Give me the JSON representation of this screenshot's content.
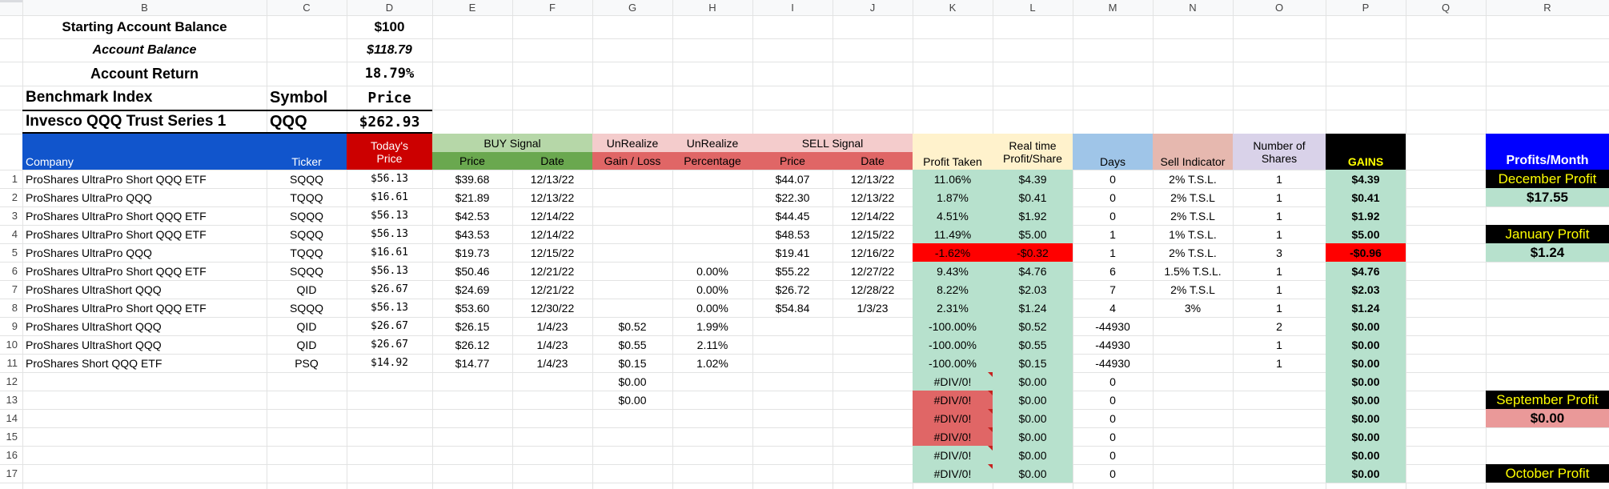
{
  "columns": [
    "B",
    "C",
    "D",
    "E",
    "F",
    "G",
    "H",
    "I",
    "J",
    "K",
    "L",
    "M",
    "N",
    "O",
    "P",
    "Q",
    "R"
  ],
  "summary": {
    "starting_balance_label": "Starting Account Balance",
    "starting_balance_value": "$100",
    "account_balance_label": "Account Balance",
    "account_balance_value": "$118.79",
    "account_return_label": "Account Return",
    "account_return_value": "18.79%",
    "benchmark_label": "Benchmark Index",
    "symbol_label": "Symbol",
    "price_label": "Price",
    "benchmark_name": "Invesco QQQ Trust Series 1",
    "benchmark_symbol": "QQQ",
    "benchmark_price": "$262.93"
  },
  "headers": {
    "company": "Company",
    "ticker": "Ticker",
    "todays_price_1": "Today's",
    "todays_price_2": "Price",
    "buy_signal": "BUY Signal",
    "buy_price": "Price",
    "buy_date": "Date",
    "unrealize_gl_top": "UnRealize",
    "unrealize_gl_bottom": "Gain / Loss",
    "unrealize_pct_top": "UnRealize",
    "unrealize_pct_bottom": "Percentage",
    "sell_signal": "SELL Signal",
    "sell_price": "Price",
    "sell_date": "Date",
    "profit_taken": "Profit Taken",
    "realtime_1": "Real time",
    "realtime_2": "Profit/Share",
    "days": "Days",
    "sell_indicator": "Sell Indicator",
    "num_shares_1": "Number of",
    "num_shares_2": "Shares",
    "gains": "GAINS",
    "profits_month": "Profits/Month"
  },
  "rows": [
    {
      "n": "1",
      "company": "ProShares UltraPro Short QQQ ETF",
      "ticker": "SQQQ",
      "today": "$56.13",
      "bp": "$39.68",
      "bd": "12/13/22",
      "gl": "",
      "pct": "",
      "sp": "$44.07",
      "sd": "12/13/22",
      "pt": "11.06%",
      "rt": "$4.39",
      "days": "0",
      "si": "2% T.S.L.",
      "sh": "1",
      "gain": "$4.39"
    },
    {
      "n": "2",
      "company": "ProShares UltraPro QQQ",
      "ticker": "TQQQ",
      "today": "$16.61",
      "bp": "$21.89",
      "bd": "12/13/22",
      "gl": "",
      "pct": "",
      "sp": "$22.30",
      "sd": "12/13/22",
      "pt": "1.87%",
      "rt": "$0.41",
      "days": "0",
      "si": "2% T.S.L",
      "sh": "1",
      "gain": "$0.41"
    },
    {
      "n": "3",
      "company": "ProShares UltraPro Short QQQ ETF",
      "ticker": "SQQQ",
      "today": "$56.13",
      "bp": "$42.53",
      "bd": "12/14/22",
      "gl": "",
      "pct": "",
      "sp": "$44.45",
      "sd": "12/14/22",
      "pt": "4.51%",
      "rt": "$1.92",
      "days": "0",
      "si": "2% T.S.L",
      "sh": "1",
      "gain": "$1.92"
    },
    {
      "n": "4",
      "company": "ProShares UltraPro Short QQQ ETF",
      "ticker": "SQQQ",
      "today": "$56.13",
      "bp": "$43.53",
      "bd": "12/14/22",
      "gl": "",
      "pct": "",
      "sp": "$48.53",
      "sd": "12/15/22",
      "pt": "11.49%",
      "rt": "$5.00",
      "days": "1",
      "si": "1% T.S.L.",
      "sh": "1",
      "gain": "$5.00"
    },
    {
      "n": "5",
      "company": "ProShares UltraPro QQQ",
      "ticker": "TQQQ",
      "today": "$16.61",
      "bp": "$19.73",
      "bd": "12/15/22",
      "gl": "",
      "pct": "",
      "sp": "$19.41",
      "sd": "12/16/22",
      "pt": "-1.62%",
      "rt": "-$0.32",
      "days": "1",
      "si": "2% T.S.L.",
      "sh": "3",
      "gain": "-$0.96"
    },
    {
      "n": "6",
      "company": "ProShares UltraPro Short QQQ ETF",
      "ticker": "SQQQ",
      "today": "$56.13",
      "bp": "$50.46",
      "bd": "12/21/22",
      "gl": "",
      "pct": "0.00%",
      "sp": "$55.22",
      "sd": "12/27/22",
      "pt": "9.43%",
      "rt": "$4.76",
      "days": "6",
      "si": "1.5% T.S.L.",
      "sh": "1",
      "gain": "$4.76"
    },
    {
      "n": "7",
      "company": "ProShares UltraShort QQQ",
      "ticker": "QID",
      "today": "$26.67",
      "bp": "$24.69",
      "bd": "12/21/22",
      "gl": "",
      "pct": "0.00%",
      "sp": "$26.72",
      "sd": "12/28/22",
      "pt": "8.22%",
      "rt": "$2.03",
      "days": "7",
      "si": "2% T.S.L",
      "sh": "1",
      "gain": "$2.03"
    },
    {
      "n": "8",
      "company": "ProShares UltraPro Short QQQ ETF",
      "ticker": "SQQQ",
      "today": "$56.13",
      "bp": "$53.60",
      "bd": "12/30/22",
      "gl": "",
      "pct": "0.00%",
      "sp": "$54.84",
      "sd": "1/3/23",
      "pt": "2.31%",
      "rt": "$1.24",
      "days": "4",
      "si": "3%",
      "sh": "1",
      "gain": "$1.24"
    },
    {
      "n": "9",
      "company": "ProShares UltraShort QQQ",
      "ticker": "QID",
      "today": "$26.67",
      "bp": "$26.15",
      "bd": "1/4/23",
      "gl": "$0.52",
      "pct": "1.99%",
      "sp": "",
      "sd": "",
      "pt": "-100.00%",
      "rt": "$0.52",
      "days": "-44930",
      "si": "",
      "sh": "2",
      "gain": "$0.00"
    },
    {
      "n": "10",
      "company": "ProShares UltraShort QQQ",
      "ticker": "QID",
      "today": "$26.67",
      "bp": "$26.12",
      "bd": "1/4/23",
      "gl": "$0.55",
      "pct": "2.11%",
      "sp": "",
      "sd": "",
      "pt": "-100.00%",
      "rt": "$0.55",
      "days": "-44930",
      "si": "",
      "sh": "1",
      "gain": "$0.00"
    },
    {
      "n": "11",
      "company": "ProShares Short QQQ ETF",
      "ticker": "PSQ",
      "today": "$14.92",
      "bp": "$14.77",
      "bd": "1/4/23",
      "gl": "$0.15",
      "pct": "1.02%",
      "sp": "",
      "sd": "",
      "pt": "-100.00%",
      "rt": "$0.15",
      "days": "-44930",
      "si": "",
      "sh": "1",
      "gain": "$0.00"
    },
    {
      "n": "12",
      "company": "",
      "ticker": "",
      "today": "",
      "bp": "",
      "bd": "",
      "gl": "$0.00",
      "pct": "",
      "sp": "",
      "sd": "",
      "pt": "#DIV/0!",
      "rt": "$0.00",
      "days": "0",
      "si": "",
      "sh": "",
      "gain": "$0.00"
    },
    {
      "n": "13",
      "company": "",
      "ticker": "",
      "today": "",
      "bp": "",
      "bd": "",
      "gl": "$0.00",
      "pct": "",
      "sp": "",
      "sd": "",
      "pt": "#DIV/0!",
      "rt": "$0.00",
      "days": "0",
      "si": "",
      "sh": "",
      "gain": "$0.00"
    },
    {
      "n": "14",
      "company": "",
      "ticker": "",
      "today": "",
      "bp": "",
      "bd": "",
      "gl": "",
      "pct": "",
      "sp": "",
      "sd": "",
      "pt": "#DIV/0!",
      "rt": "$0.00",
      "days": "0",
      "si": "",
      "sh": "",
      "gain": "$0.00"
    },
    {
      "n": "15",
      "company": "",
      "ticker": "",
      "today": "",
      "bp": "",
      "bd": "",
      "gl": "",
      "pct": "",
      "sp": "",
      "sd": "",
      "pt": "#DIV/0!",
      "rt": "$0.00",
      "days": "0",
      "si": "",
      "sh": "",
      "gain": "$0.00"
    },
    {
      "n": "16",
      "company": "",
      "ticker": "",
      "today": "",
      "bp": "",
      "bd": "",
      "gl": "",
      "pct": "",
      "sp": "",
      "sd": "",
      "pt": "#DIV/0!",
      "rt": "$0.00",
      "days": "0",
      "si": "",
      "sh": "",
      "gain": "$0.00"
    },
    {
      "n": "17",
      "company": "",
      "ticker": "",
      "today": "",
      "bp": "",
      "bd": "",
      "gl": "",
      "pct": "",
      "sp": "",
      "sd": "",
      "pt": "#DIV/0!",
      "rt": "$0.00",
      "days": "0",
      "si": "",
      "sh": "",
      "gain": "$0.00"
    }
  ],
  "months": {
    "december_label": "December Profit",
    "december_value": "$17.55",
    "january_label": "January Profit",
    "january_value": "$1.24",
    "september_label": "September Profit",
    "september_value": "$0.00",
    "october_label": "October Profit"
  },
  "colors": {
    "header_blue": "#1155cc",
    "today_red": "#cc0000",
    "buy_light": "#b6d7a8",
    "buy_dark": "#6aa84f",
    "unrealize": "#f4cccc",
    "unrealize_dark": "#e06666",
    "sell_light": "#f4cccc",
    "sell_dark": "#e06666",
    "profit_hdr": "#fff2cc",
    "days_hdr": "#9fc5e8",
    "sellind_hdr": "#e6b8af",
    "shares_hdr": "#d9d2e9",
    "gains_black": "#000000",
    "green_cell": "#b7e1cd",
    "red_cell": "#ff0000",
    "error_red": "#e06666",
    "profits_blue": "#0000ff",
    "month_yellow": "#ffff00",
    "pink": "#ea9999"
  }
}
